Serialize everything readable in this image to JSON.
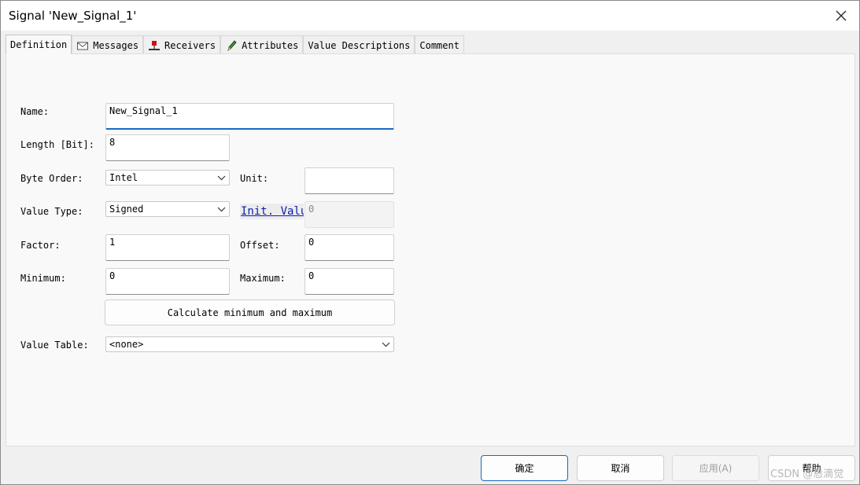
{
  "window": {
    "title": "Signal 'New_Signal_1'"
  },
  "tabs": [
    {
      "label": "Definition",
      "icon": "none",
      "active": true
    },
    {
      "label": "Messages",
      "icon": "envelope-icon",
      "active": false
    },
    {
      "label": "Receivers",
      "icon": "node-flag-icon",
      "active": false
    },
    {
      "label": "Attributes",
      "icon": "pencil-icon",
      "active": false
    },
    {
      "label": "Value Descriptions",
      "icon": "none",
      "active": false
    },
    {
      "label": "Comment",
      "icon": "none",
      "active": false
    }
  ],
  "form": {
    "name": {
      "label": "Name:",
      "value": "New_Signal_1"
    },
    "length": {
      "label": "Length [Bit]:",
      "value": "8"
    },
    "byte_order": {
      "label": "Byte Order:",
      "value": "Intel"
    },
    "unit": {
      "label": "Unit:",
      "value": ""
    },
    "value_type": {
      "label": "Value Type:",
      "value": "Signed"
    },
    "init_value": {
      "label": "Init. Valu",
      "value": "0"
    },
    "factor": {
      "label": "Factor:",
      "value": "1"
    },
    "offset": {
      "label": "Offset:",
      "value": "0"
    },
    "minimum": {
      "label": "Minimum:",
      "value": "0"
    },
    "maximum": {
      "label": "Maximum:",
      "value": "0"
    },
    "calc_button": "Calculate minimum and maximum",
    "value_table": {
      "label": "Value Table:",
      "value": "<none>"
    }
  },
  "footer": {
    "ok": "确定",
    "cancel": "取消",
    "apply": "应用(A)",
    "help": "帮助"
  },
  "watermark": "CSDN @恳滴觉",
  "colors": {
    "accent": "#1a68c0",
    "link": "#0b1fa8"
  }
}
